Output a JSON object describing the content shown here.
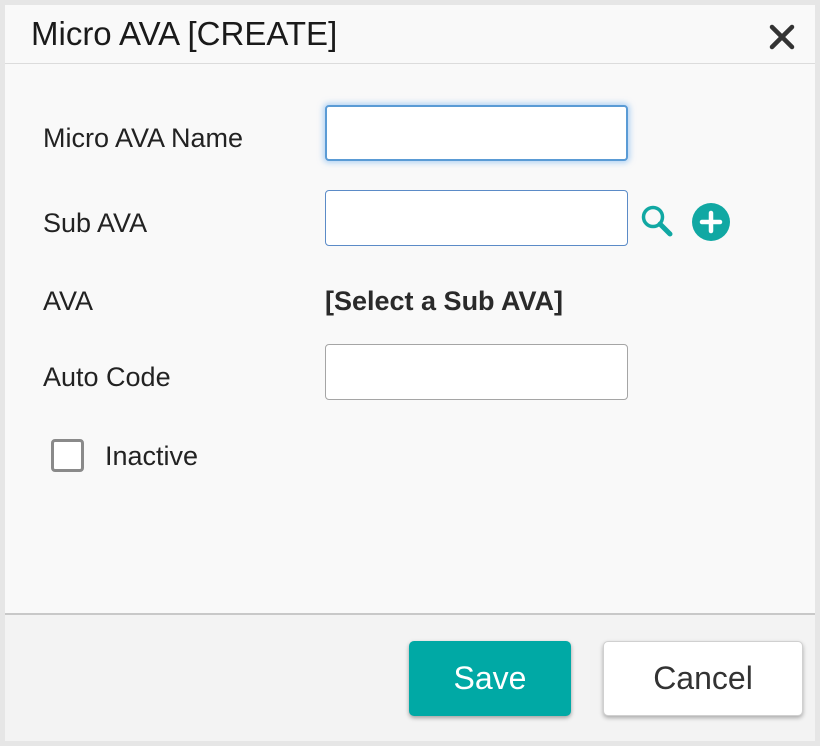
{
  "dialog": {
    "title": "Micro AVA [CREATE]",
    "close_icon": "close-icon"
  },
  "form": {
    "micro_ava_name": {
      "label": "Micro AVA Name",
      "value": ""
    },
    "sub_ava": {
      "label": "Sub AVA",
      "value": "",
      "search_icon": "search-icon",
      "add_icon": "plus-circle-icon"
    },
    "ava": {
      "label": "AVA",
      "value": "[Select a Sub AVA]"
    },
    "auto_code": {
      "label": "Auto Code",
      "value": ""
    },
    "inactive": {
      "label": "Inactive",
      "checked": false
    }
  },
  "footer": {
    "save_label": "Save",
    "cancel_label": "Cancel"
  },
  "colors": {
    "accent": "#00a9a5",
    "focus_border": "#5a9bd5"
  }
}
